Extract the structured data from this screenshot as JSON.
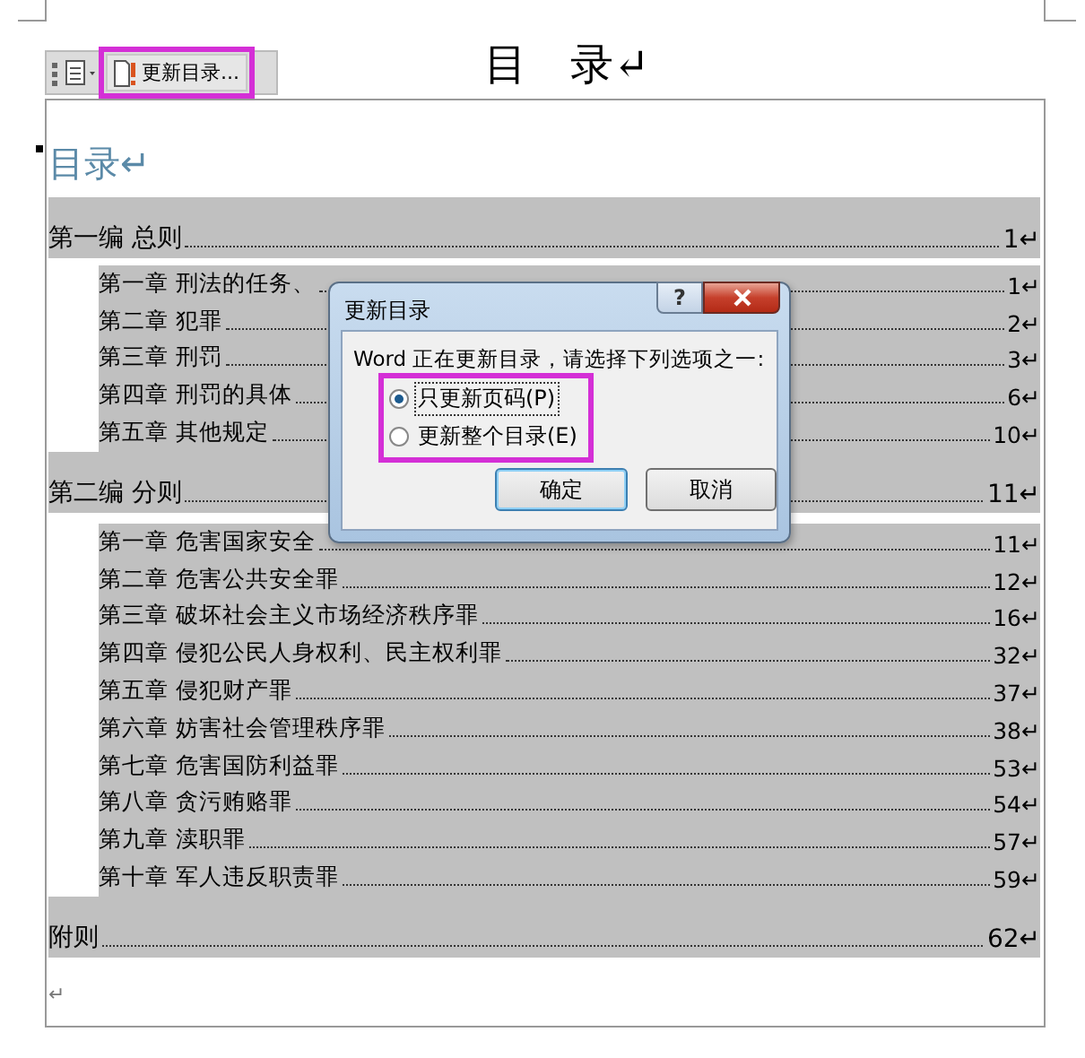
{
  "toolbar": {
    "update_button": {
      "label": "更新目录...",
      "highlighted": true
    }
  },
  "page_title": "目　录↵",
  "toc": {
    "heading": "目录↵",
    "entries": [
      {
        "kind": "part",
        "title": "第一编 总则",
        "page": "1↵"
      },
      {
        "kind": "chapter",
        "title": "第一章 刑法的任务、",
        "page": "1↵"
      },
      {
        "kind": "chapter",
        "title": "第二章 犯罪",
        "page": "2↵"
      },
      {
        "kind": "chapter",
        "title": "第三章 刑罚",
        "page": "3↵"
      },
      {
        "kind": "chapter",
        "title": "第四章 刑罚的具体",
        "page": "6↵"
      },
      {
        "kind": "chapter",
        "title": "第五章 其他规定",
        "page": "10↵"
      },
      {
        "kind": "part",
        "title": "第二编 分则",
        "page": "11↵"
      },
      {
        "kind": "chapter",
        "title": "第一章 危害国家安全",
        "page": "11↵"
      },
      {
        "kind": "chapter",
        "title": "第二章 危害公共安全罪",
        "page": "12↵"
      },
      {
        "kind": "chapter",
        "title": "第三章 破坏社会主义市场经济秩序罪",
        "page": "16↵"
      },
      {
        "kind": "chapter",
        "title": "第四章 侵犯公民人身权利、民主权利罪",
        "page": "32↵"
      },
      {
        "kind": "chapter",
        "title": "第五章 侵犯财产罪",
        "page": "37↵"
      },
      {
        "kind": "chapter",
        "title": "第六章 妨害社会管理秩序罪",
        "page": "38↵"
      },
      {
        "kind": "chapter",
        "title": "第七章 危害国防利益罪",
        "page": "53↵"
      },
      {
        "kind": "chapter",
        "title": "第八章 贪污贿赂罪",
        "page": "54↵"
      },
      {
        "kind": "chapter",
        "title": "第九章 渎职罪",
        "page": "57↵"
      },
      {
        "kind": "chapter",
        "title": "第十章 军人违反职责罪",
        "page": "59↵"
      },
      {
        "kind": "part",
        "title": "附则",
        "page": "62↵"
      }
    ],
    "end_mark": "↵"
  },
  "dialog": {
    "title": "更新目录",
    "help_label": "?",
    "message": "Word 正在更新目录，请选择下列选项之一:",
    "options_highlighted": true,
    "options": [
      {
        "label": "只更新页码(P)",
        "selected": true
      },
      {
        "label": "更新整个目录(E)",
        "selected": false
      }
    ],
    "buttons": [
      {
        "label": "确定",
        "default": true
      },
      {
        "label": "取消",
        "default": false
      }
    ]
  }
}
